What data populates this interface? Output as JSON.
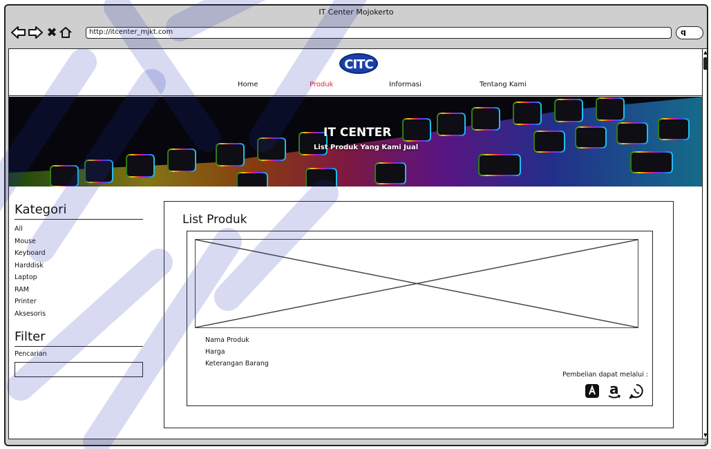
{
  "window": {
    "title": "IT Center Mojokerto"
  },
  "toolbar": {
    "url": "http://itcenter_mjkt.com",
    "search_glyph": "q"
  },
  "header": {
    "logo_text": "CITC",
    "nav": [
      {
        "label": "Home",
        "active": false
      },
      {
        "label": "Produk",
        "active": true
      },
      {
        "label": "Informasi",
        "active": false
      },
      {
        "label": "Tentang Kami",
        "active": false
      }
    ],
    "active_color": "#d9282b"
  },
  "banner": {
    "title": "IT CENTER",
    "subtitle": "List Produk Yang Kami Jual"
  },
  "sidebar": {
    "kategori_heading": "Kategori",
    "categories": [
      "All",
      "Mouse",
      "Keyboard",
      "Harddisk",
      "Laptop",
      "RAM",
      "Printer",
      "Aksesoris"
    ],
    "filter_heading": "Filter",
    "search_label": "Pencarian",
    "search_value": ""
  },
  "main": {
    "title": "List Produk",
    "product": {
      "name_label": "Nama Produk",
      "price_label": "Harga",
      "desc_label": "Keterangan Barang",
      "buy_label": "Pembelian dapat melalui :",
      "channels": [
        {
          "name": "A",
          "icon": "app-store-icon"
        },
        {
          "name": "a",
          "icon": "amazon-icon"
        },
        {
          "name": "",
          "icon": "whatsapp-icon"
        }
      ]
    }
  }
}
